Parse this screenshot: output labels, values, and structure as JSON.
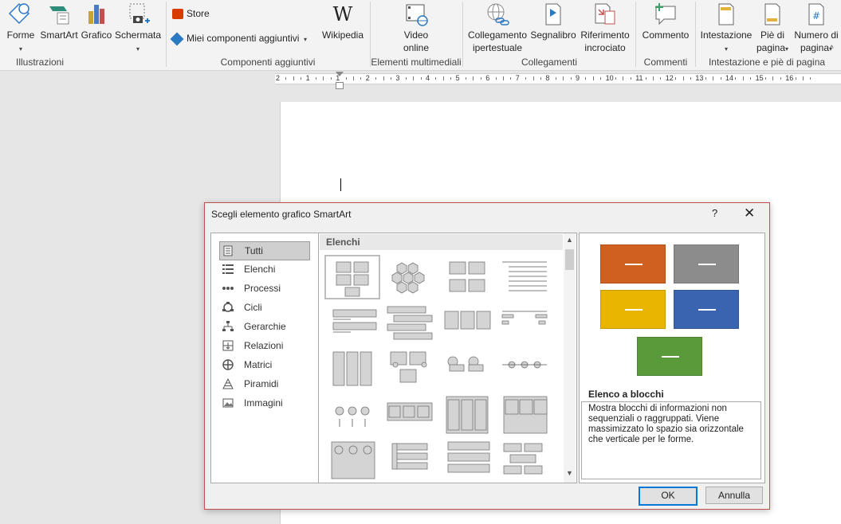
{
  "ribbon": {
    "groups": [
      {
        "label": "Illustrazioni"
      },
      {
        "label": "Componenti aggiuntivi"
      },
      {
        "label": "Elementi multimediali"
      },
      {
        "label": "Collegamenti"
      },
      {
        "label": "Commenti"
      },
      {
        "label": "Intestazione e piè di pagina"
      }
    ],
    "illustrations": {
      "forme": "Forme",
      "smartart": "SmartArt",
      "grafico": "Grafico",
      "schermata": "Schermata"
    },
    "addins": {
      "store": "Store",
      "miei": "Miei componenti aggiuntivi",
      "wikipedia": "Wikipedia"
    },
    "media": {
      "video_line1": "Video",
      "video_line2": "online"
    },
    "links": {
      "hyper_line1": "Collegamento",
      "hyper_line2": "ipertestuale",
      "bookmark": "Segnalibro",
      "cross_line1": "Riferimento",
      "cross_line2": "incrociato"
    },
    "comments": {
      "comment": "Commento"
    },
    "header_footer": {
      "header": "Intestazione",
      "footer_line1": "Piè di",
      "footer_line2": "pagina",
      "pagenum_line1": "Numero di",
      "pagenum_line2": "pagina"
    }
  },
  "ruler": {
    "labels": [
      "2",
      "1",
      "1",
      "2",
      "3",
      "4",
      "5",
      "6",
      "7",
      "8",
      "9",
      "10",
      "11",
      "12",
      "13",
      "14",
      "15",
      "16"
    ]
  },
  "dialog": {
    "title": "Scegli elemento grafico SmartArt",
    "help": "?",
    "close": "✕",
    "categories": [
      {
        "label": "Tutti",
        "icon": "all-icon"
      },
      {
        "label": "Elenchi",
        "icon": "list-icon"
      },
      {
        "label": "Processi",
        "icon": "process-icon"
      },
      {
        "label": "Cicli",
        "icon": "cycle-icon"
      },
      {
        "label": "Gerarchie",
        "icon": "hierarchy-icon"
      },
      {
        "label": "Relazioni",
        "icon": "relationship-icon"
      },
      {
        "label": "Matrici",
        "icon": "matrix-icon"
      },
      {
        "label": "Piramidi",
        "icon": "pyramid-icon"
      },
      {
        "label": "Immagini",
        "icon": "picture-icon"
      }
    ],
    "selected_category": "Tutti",
    "grid_header": "Elenchi",
    "preview": {
      "title": "Elenco a blocchi",
      "description": "Mostra blocchi di informazioni non sequenziali o raggruppati. Viene massimizzato lo spazio sia orizzontale che verticale per le forme.",
      "block_colors": [
        "#d0601f",
        "#8c8c8c",
        "#e8b500",
        "#3a64b0",
        "#5a9a3a"
      ]
    },
    "ok": "OK",
    "cancel": "Annulla"
  }
}
